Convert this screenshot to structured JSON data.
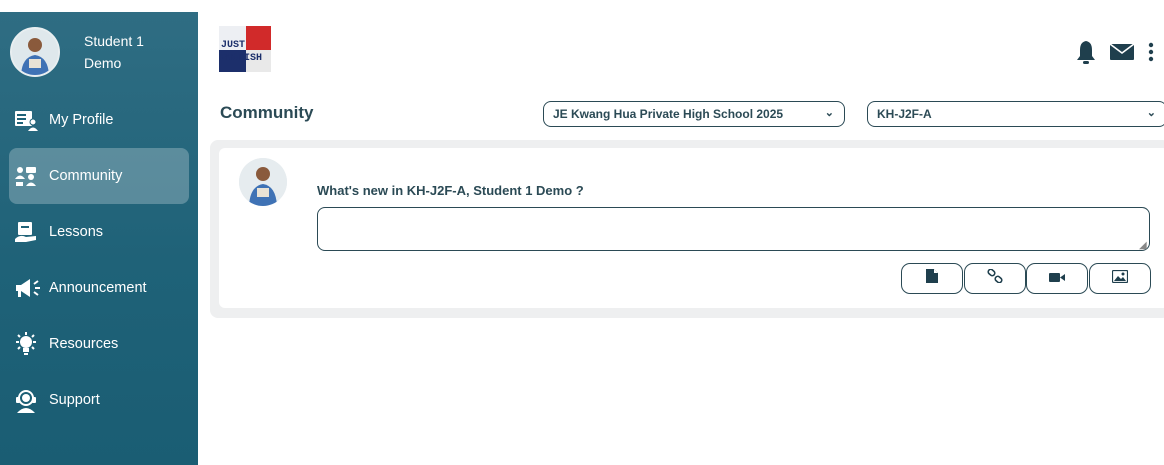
{
  "user": {
    "first_line": "Student 1",
    "second_line": "Demo"
  },
  "sidebar": {
    "items": [
      {
        "label": "My Profile",
        "icon": "profile-card-icon",
        "active": false
      },
      {
        "label": "Community",
        "icon": "community-icon",
        "active": true
      },
      {
        "label": "Lessons",
        "icon": "lessons-icon",
        "active": false
      },
      {
        "label": "Announcement",
        "icon": "megaphone-icon",
        "active": false
      },
      {
        "label": "Resources",
        "icon": "lightbulb-icon",
        "active": false
      },
      {
        "label": "Support",
        "icon": "headset-icon",
        "active": false
      }
    ]
  },
  "logo": {
    "line1": "JUST",
    "line2": "ENGLISH"
  },
  "header": {
    "icons": [
      "bell-icon",
      "mail-icon",
      "more-vertical-icon"
    ]
  },
  "page": {
    "title": "Community",
    "school_select": "JE Kwang Hua Private High School 2025",
    "class_select": "KH-J2F-A"
  },
  "composer": {
    "prompt": "What's new in KH-J2F-A, Student 1 Demo ?",
    "input_value": "",
    "attach_icons": [
      "file-icon",
      "link-icon",
      "video-camera-icon",
      "image-icon"
    ]
  },
  "colors": {
    "sidebar": "#1f6278",
    "accent_text": "#2b4a55",
    "panel_bg": "#eeeff0"
  }
}
